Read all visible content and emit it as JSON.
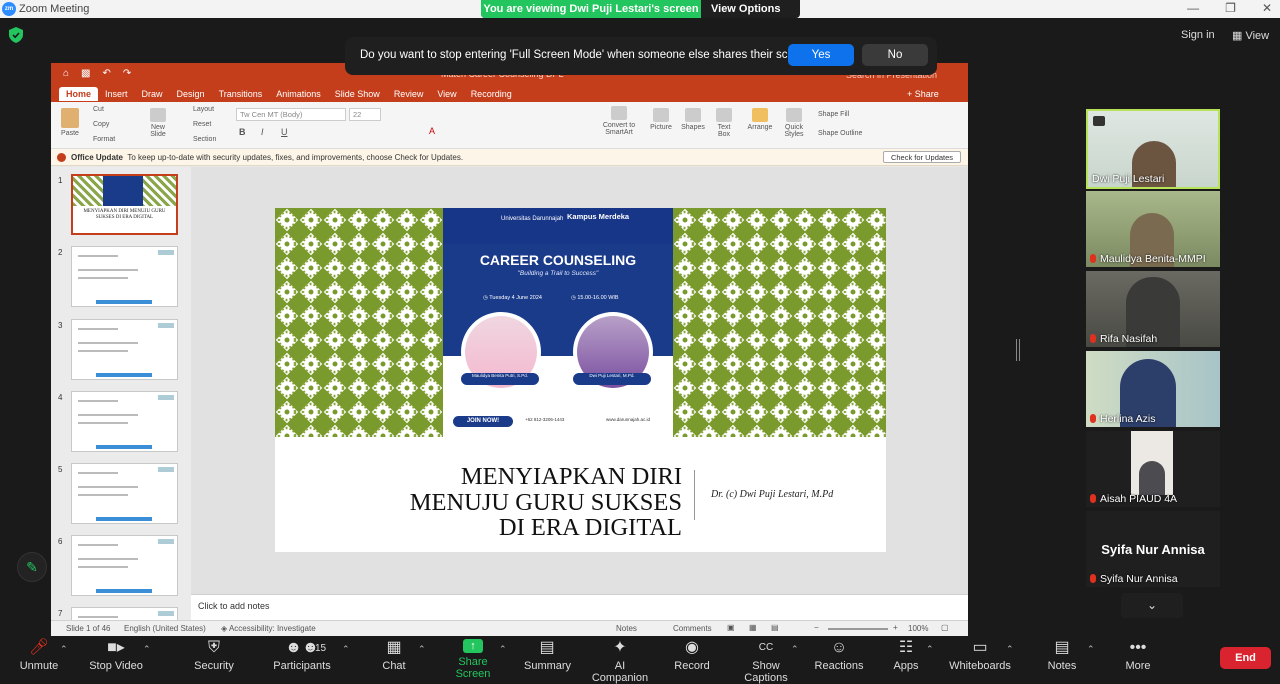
{
  "window": {
    "title": "Zoom Meeting",
    "logo_text": "zm"
  },
  "banner": {
    "viewing": "You are viewing Dwi Puji Lestari's screen",
    "view_options": "View Options"
  },
  "topright": {
    "sign_in": "Sign in",
    "view": "View"
  },
  "popup": {
    "message": "Do you want to stop entering 'Full Screen Mode' when someone else shares their screen?",
    "yes": "Yes",
    "no": "No"
  },
  "ppt": {
    "file_title": "Materi Career Counseling DPL",
    "search_placeholder": "Search in Presentation",
    "tabs": [
      "Home",
      "Insert",
      "Draw",
      "Design",
      "Transitions",
      "Animations",
      "Slide Show",
      "Review",
      "View",
      "Recording"
    ],
    "share": "Share",
    "ribbon": {
      "paste": "Paste",
      "cut": "Cut",
      "copy": "Copy",
      "format": "Format",
      "new_slide": "New Slide",
      "layout": "Layout",
      "reset": "Reset",
      "section": "Section",
      "font_name": "Tw Cen MT (Body)",
      "font_size": "22",
      "convert_smartart": "Convert to SmartArt",
      "picture": "Picture",
      "shapes": "Shapes",
      "text_box": "Text Box",
      "arrange": "Arrange",
      "quick_styles": "Quick Styles",
      "shape_fill": "Shape Fill",
      "shape_outline": "Shape Outline"
    },
    "update_bar": {
      "label": "Office Update",
      "text": "To keep up-to-date with security updates, fixes, and improvements, choose Check for Updates.",
      "button": "Check for Updates"
    },
    "thumbnails": [
      {
        "num": "1",
        "caption": "MENYIAPKAN DIRI MENUJU GURU SUKSES DI ERA DIGITAL"
      },
      {
        "num": "2",
        "caption": ""
      },
      {
        "num": "3",
        "caption": ""
      },
      {
        "num": "4",
        "caption": ""
      },
      {
        "num": "5",
        "caption": ""
      },
      {
        "num": "6",
        "caption": ""
      },
      {
        "num": "7",
        "caption": ""
      }
    ],
    "slide": {
      "uni": "Universitas Darunnajah",
      "kampus": "Kampus Merdeka",
      "event_title": "CAREER COUNSELING",
      "event_subtitle": "\"Building a Trail to Success\"",
      "date": "Tuesday 4 June 2024",
      "time": "15.00-16.00 WIB",
      "speaker1": "Maulidya Benita Putri, S.Pd.",
      "speaker2": "Dwi Puji Lestari, M.Pd.",
      "join": "JOIN NOW!",
      "phone": "+62 812-3206-1443",
      "website": "www.darunnajah.ac.id",
      "title_lines": [
        "MENYIAPKAN DIRI",
        "MENUJU GURU SUKSES",
        "DI ERA DIGITAL"
      ],
      "author": "Dr. (c) Dwi Puji Lestari, M.Pd"
    },
    "notes_placeholder": "Click to add notes",
    "status": {
      "slide": "Slide 1 of 46",
      "lang": "English (United States)",
      "access": "Accessibility: Investigate",
      "notes": "Notes",
      "comments": "Comments",
      "zoom": "100%"
    }
  },
  "participants": [
    {
      "name": "Dwi Puji Lestari",
      "muted": false
    },
    {
      "name": "Maulidya Benita-MMPI",
      "muted": true
    },
    {
      "name": "Rifa Nasifah",
      "muted": true
    },
    {
      "name": "Herlina Azis",
      "muted": true
    },
    {
      "name": "Aisah PIAUD 4A",
      "muted": true
    },
    {
      "name": "Syifa Nur Annisa",
      "muted": true
    }
  ],
  "toolbar": {
    "unmute": "Unmute",
    "stop_video": "Stop Video",
    "security": "Security",
    "participants": "Participants",
    "participant_count": "15",
    "chat": "Chat",
    "share_screen": "Share Screen",
    "summary": "Summary",
    "ai_companion": "AI Companion",
    "record": "Record",
    "show_captions": "Show Captions",
    "reactions": "Reactions",
    "apps": "Apps",
    "whiteboards": "Whiteboards",
    "notes": "Notes",
    "more": "More",
    "end": "End"
  },
  "colors": {
    "zoom_green": "#23c55e",
    "zoom_blue": "#0e72ed",
    "ppt_red": "#c43e1c",
    "end_red": "#d9232e"
  }
}
